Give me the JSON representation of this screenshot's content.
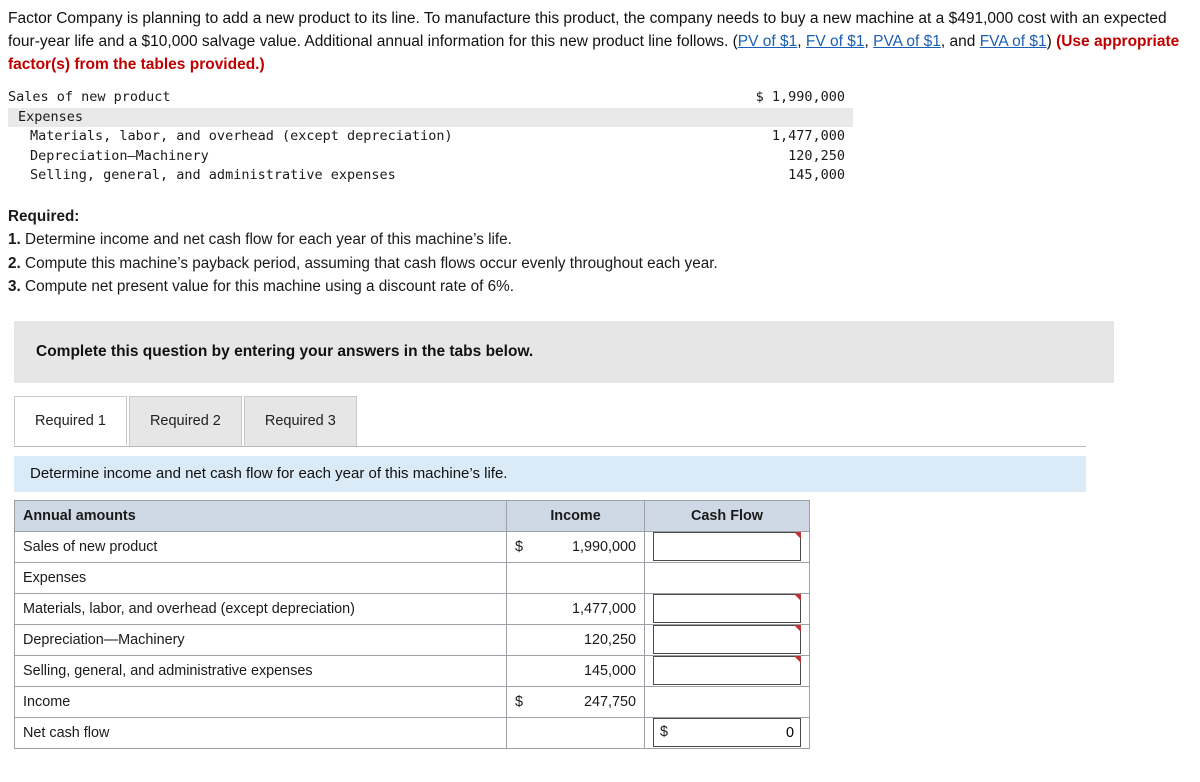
{
  "intro": {
    "part1": "Factor Company is planning to add a new product to its line. To manufacture this product, the company needs to buy a new machine at a $491,000 cost with an expected four-year life and a $10,000 salvage value. Additional annual information for this new product line follows. (",
    "link1": "PV of $1",
    "sep1": ", ",
    "link2": "FV of $1",
    "sep2": ", ",
    "link3": "PVA of $1",
    "sep3": ", and ",
    "link4": "FVA of $1",
    "part2": ") ",
    "bold_red": "(Use appropriate factor(s) from the tables provided.)"
  },
  "data_block": [
    {
      "label": "Sales of new product",
      "value": "$ 1,990,000",
      "shaded": false,
      "indent": 0
    },
    {
      "label": "Expenses",
      "value": "",
      "shaded": true,
      "indent": 0
    },
    {
      "label": "Materials, labor, and overhead (except depreciation)",
      "value": "1,477,000",
      "shaded": false,
      "indent": 1
    },
    {
      "label": "Depreciation—Machinery",
      "value": "120,250",
      "shaded": false,
      "indent": 1
    },
    {
      "label": "Selling, general, and administrative expenses",
      "value": "145,000",
      "shaded": false,
      "indent": 1
    }
  ],
  "required": {
    "heading": "Required:",
    "items": [
      {
        "num": "1.",
        "text": "Determine income and net cash flow for each year of this machine’s life."
      },
      {
        "num": "2.",
        "text": "Compute this machine’s payback period, assuming that cash flows occur evenly throughout each year."
      },
      {
        "num": "3.",
        "text": "Compute net present value for this machine using a discount rate of 6%."
      }
    ]
  },
  "banner": "Complete this question by entering your answers in the tabs below.",
  "tabs": [
    {
      "label": "Required 1",
      "active": true
    },
    {
      "label": "Required 2",
      "active": false
    },
    {
      "label": "Required 3",
      "active": false
    }
  ],
  "instruction": "Determine income and net cash flow for each year of this machine’s life.",
  "table": {
    "headers": {
      "label": "Annual amounts",
      "income": "Income",
      "cash": "Cash Flow"
    },
    "rows": [
      {
        "label": "Sales of new product",
        "indent": 0,
        "income_dollar": "$",
        "income": "1,990,000",
        "cash_input": true,
        "cash_value": "",
        "cash_dollar": "",
        "flag": true
      },
      {
        "label": "Expenses",
        "indent": 0,
        "income_dollar": "",
        "income": "",
        "cash_input": false,
        "cash_value": "",
        "cash_dollar": "",
        "flag": false
      },
      {
        "label": "Materials, labor, and overhead (except depreciation)",
        "indent": 1,
        "income_dollar": "",
        "income": "1,477,000",
        "cash_input": true,
        "cash_value": "",
        "cash_dollar": "",
        "flag": true
      },
      {
        "label": "Depreciation—Machinery",
        "indent": 1,
        "income_dollar": "",
        "income": "120,250",
        "cash_input": true,
        "cash_value": "",
        "cash_dollar": "",
        "flag": true
      },
      {
        "label": "Selling, general, and administrative expenses",
        "indent": 1,
        "income_dollar": "",
        "income": "145,000",
        "cash_input": true,
        "cash_value": "",
        "cash_dollar": "",
        "flag": true
      },
      {
        "label": "Income",
        "indent": 0,
        "income_dollar": "$",
        "income": "247,750",
        "cash_input": false,
        "cash_value": "",
        "cash_dollar": "",
        "flag": false
      },
      {
        "label": "Net cash flow",
        "indent": 0,
        "income_dollar": "",
        "income": "",
        "cash_input": true,
        "cash_value": "0",
        "cash_dollar": "$",
        "flag": false
      }
    ]
  },
  "colors": {
    "link": "#1a5fb4",
    "red_bold": "#c00000",
    "header_bg": "#cfd9e6",
    "banner_bg": "#e6e6e6",
    "instruction_bg": "#dbeaf7"
  }
}
